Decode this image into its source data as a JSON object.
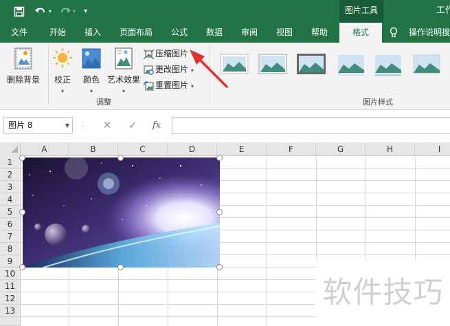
{
  "titlebar": {
    "context_tools_label": "图片工具",
    "title_partial": "工作"
  },
  "tabs": {
    "file": "文件",
    "home": "开始",
    "insert": "插入",
    "page_layout": "页面布局",
    "formulas": "公式",
    "data": "数据",
    "review": "审阅",
    "view": "视图",
    "help": "帮助",
    "format": "格式",
    "tell_me": "操作说明搜"
  },
  "ribbon": {
    "remove_background": "删除背景",
    "corrections": "校正",
    "color": "颜色",
    "artistic_effects": "艺术效果",
    "compress_pictures": "压缩图片",
    "change_picture": "更改图片",
    "reset_picture": "重置图片",
    "group_adjust": "调整",
    "group_picture_styles": "图片样式"
  },
  "formula_bar": {
    "name_box": "图片 8",
    "fx": "fx",
    "formula": ""
  },
  "grid": {
    "columns": [
      "A",
      "B",
      "C",
      "D",
      "E",
      "F",
      "G",
      "H",
      "I"
    ],
    "rows": [
      "1",
      "2",
      "3",
      "4",
      "5",
      "6",
      "7",
      "8",
      "9",
      "10",
      "11",
      "12",
      "13"
    ]
  },
  "watermark": "软件技巧",
  "colors": {
    "excel_green": "#217346",
    "context_tab_dark": "#185c37",
    "ribbon_bg": "#f3f3f3",
    "arrow_red": "#e03030"
  }
}
